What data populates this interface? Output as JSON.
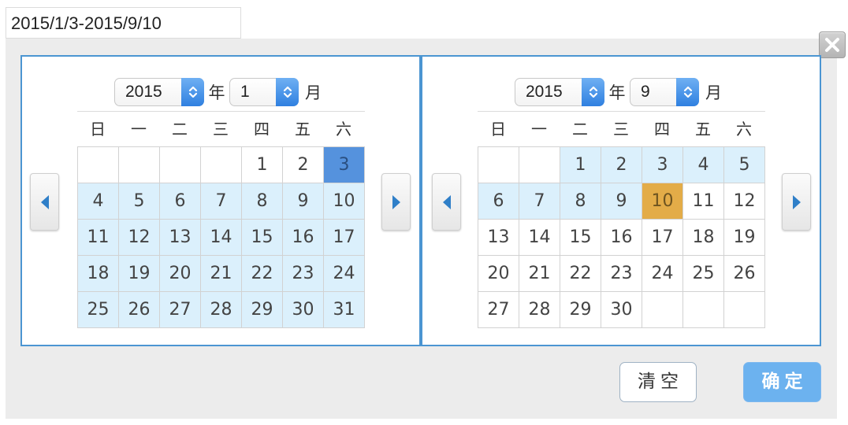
{
  "range_input": {
    "value": "2015/1/3-2015/9/10"
  },
  "left_calendar": {
    "year": "2015",
    "month": "1",
    "year_label": "年",
    "month_label": "月",
    "weekdays": [
      "日",
      "一",
      "二",
      "三",
      "四",
      "五",
      "六"
    ],
    "weeks": [
      [
        {
          "d": ""
        },
        {
          "d": ""
        },
        {
          "d": ""
        },
        {
          "d": ""
        },
        {
          "d": "1"
        },
        {
          "d": "2"
        },
        {
          "d": "3",
          "s": "start"
        }
      ],
      [
        {
          "d": "4",
          "s": "inrange"
        },
        {
          "d": "5",
          "s": "inrange"
        },
        {
          "d": "6",
          "s": "inrange"
        },
        {
          "d": "7",
          "s": "inrange"
        },
        {
          "d": "8",
          "s": "inrange"
        },
        {
          "d": "9",
          "s": "inrange"
        },
        {
          "d": "10",
          "s": "inrange"
        }
      ],
      [
        {
          "d": "11",
          "s": "inrange"
        },
        {
          "d": "12",
          "s": "inrange"
        },
        {
          "d": "13",
          "s": "inrange"
        },
        {
          "d": "14",
          "s": "inrange"
        },
        {
          "d": "15",
          "s": "inrange"
        },
        {
          "d": "16",
          "s": "inrange"
        },
        {
          "d": "17",
          "s": "inrange"
        }
      ],
      [
        {
          "d": "18",
          "s": "inrange"
        },
        {
          "d": "19",
          "s": "inrange"
        },
        {
          "d": "20",
          "s": "inrange"
        },
        {
          "d": "21",
          "s": "inrange"
        },
        {
          "d": "22",
          "s": "inrange"
        },
        {
          "d": "23",
          "s": "inrange"
        },
        {
          "d": "24",
          "s": "inrange"
        }
      ],
      [
        {
          "d": "25",
          "s": "inrange"
        },
        {
          "d": "26",
          "s": "inrange"
        },
        {
          "d": "27",
          "s": "inrange"
        },
        {
          "d": "28",
          "s": "inrange"
        },
        {
          "d": "29",
          "s": "inrange"
        },
        {
          "d": "30",
          "s": "inrange"
        },
        {
          "d": "31",
          "s": "inrange"
        }
      ]
    ]
  },
  "right_calendar": {
    "year": "2015",
    "month": "9",
    "year_label": "年",
    "month_label": "月",
    "weekdays": [
      "日",
      "一",
      "二",
      "三",
      "四",
      "五",
      "六"
    ],
    "weeks": [
      [
        {
          "d": ""
        },
        {
          "d": ""
        },
        {
          "d": "1",
          "s": "inrange"
        },
        {
          "d": "2",
          "s": "inrange"
        },
        {
          "d": "3",
          "s": "inrange"
        },
        {
          "d": "4",
          "s": "inrange"
        },
        {
          "d": "5",
          "s": "inrange"
        }
      ],
      [
        {
          "d": "6",
          "s": "inrange"
        },
        {
          "d": "7",
          "s": "inrange"
        },
        {
          "d": "8",
          "s": "inrange"
        },
        {
          "d": "9",
          "s": "inrange"
        },
        {
          "d": "10",
          "s": "today"
        },
        {
          "d": "11"
        },
        {
          "d": "12"
        }
      ],
      [
        {
          "d": "13"
        },
        {
          "d": "14"
        },
        {
          "d": "15"
        },
        {
          "d": "16"
        },
        {
          "d": "17"
        },
        {
          "d": "18"
        },
        {
          "d": "19"
        }
      ],
      [
        {
          "d": "20"
        },
        {
          "d": "21"
        },
        {
          "d": "22"
        },
        {
          "d": "23"
        },
        {
          "d": "24"
        },
        {
          "d": "25"
        },
        {
          "d": "26"
        }
      ],
      [
        {
          "d": "27"
        },
        {
          "d": "28"
        },
        {
          "d": "29"
        },
        {
          "d": "30"
        },
        {
          "d": ""
        },
        {
          "d": ""
        },
        {
          "d": ""
        }
      ]
    ]
  },
  "buttons": {
    "clear": "清空",
    "confirm": "确定"
  },
  "icons": {
    "close": "close-icon",
    "prev": "chevron-left-icon",
    "next": "chevron-right-icon",
    "spinner": "up-down-icon"
  },
  "colors": {
    "accent": "#4b95d2",
    "range": "#dbf0fc",
    "start": "#5592dd",
    "today": "#e3ac48",
    "confirm": "#6cb2ef"
  }
}
